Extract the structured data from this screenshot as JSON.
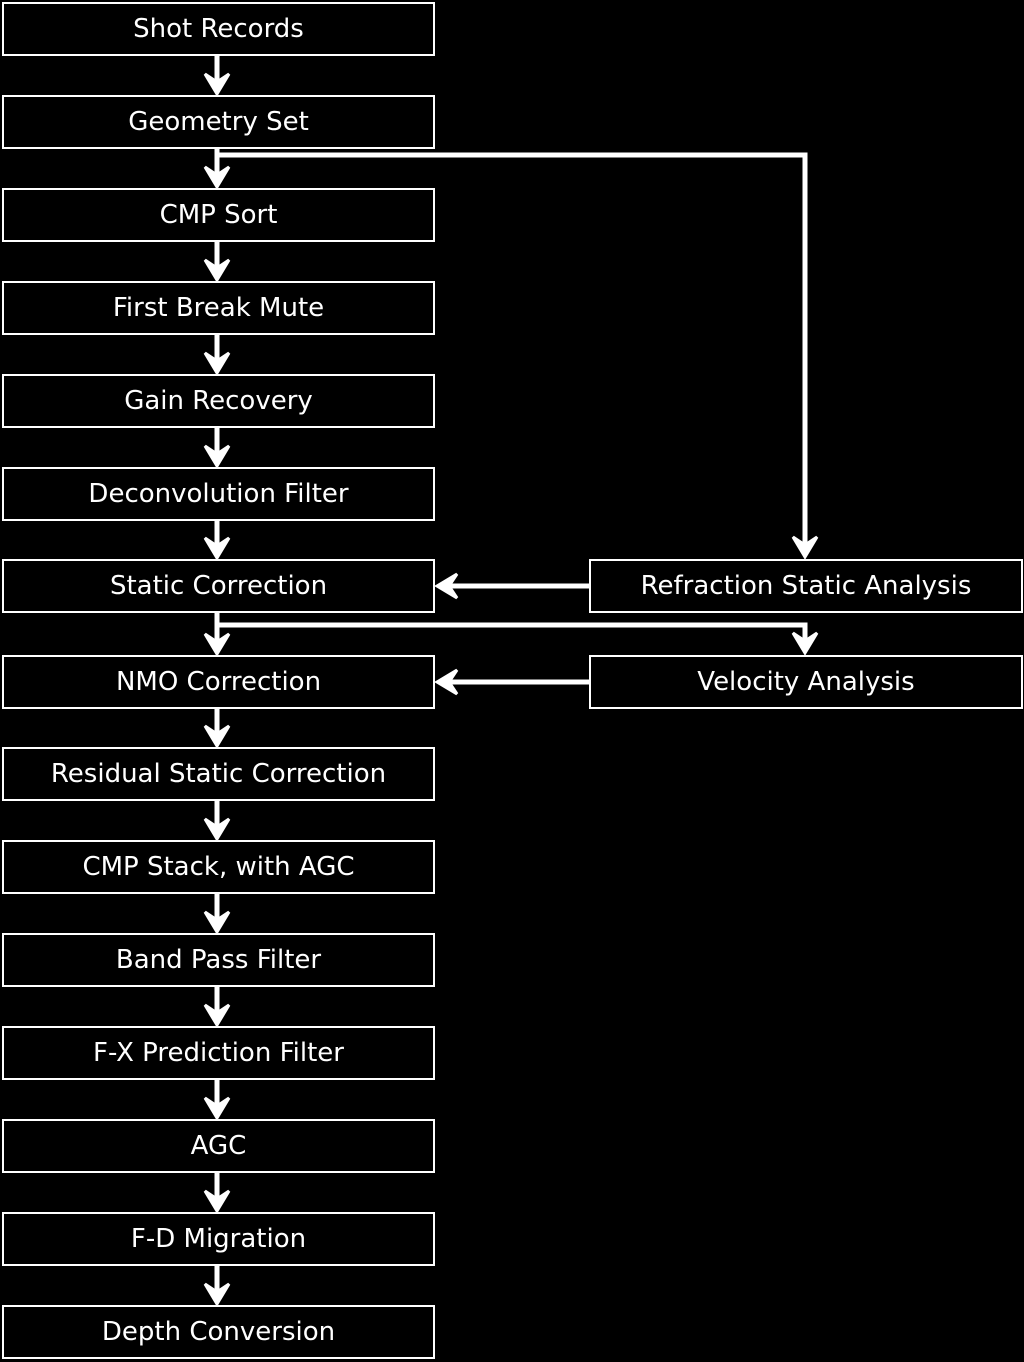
{
  "colors": {
    "background": "#000000",
    "foreground": "#ffffff"
  },
  "main_flow": [
    "Shot Records",
    "Geometry Set",
    "CMP Sort",
    "First Break Mute",
    "Gain Recovery",
    "Deconvolution Filter",
    "Static Correction",
    "NMO Correction",
    "Residual Static Correction",
    "CMP Stack, with AGC",
    "Band Pass Filter",
    "F-X Prediction Filter",
    "AGC",
    "F-D Migration",
    "Depth Conversion"
  ],
  "side_boxes": [
    {
      "label": "Refraction Static Analysis",
      "input_from": "Geometry Set",
      "output_to": "Static Correction"
    },
    {
      "label": "Velocity Analysis",
      "input_from": "Static Correction",
      "output_to": "NMO Correction"
    }
  ]
}
